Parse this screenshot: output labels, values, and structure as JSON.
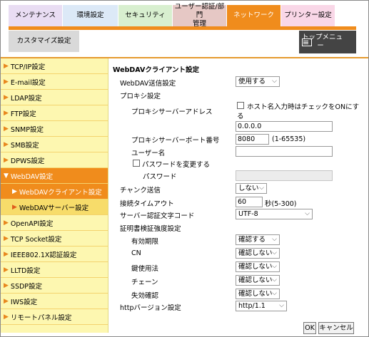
{
  "tabs": {
    "maintenance": "メンテナンス",
    "environment": "環境設定",
    "security": "セキュリティ",
    "user_auth_line1": "ユーザー認証/部門",
    "user_auth_line2": "管理",
    "network": "ネットワーク",
    "printer": "プリンター設定",
    "customize": "カスタマイズ設定"
  },
  "top_menu": {
    "line1": "トップメニュ",
    "line2": "ー"
  },
  "sidebar": {
    "items": [
      "TCP/IP設定",
      "E-mail設定",
      "LDAP設定",
      "FTP設定",
      "SNMP設定",
      "SMB設定",
      "DPWS設定",
      "WebDAV設定",
      "WebDAVクライアント設定",
      "WebDAVサーバー設定",
      "OpenAPI設定",
      "TCP Socket設定",
      "IEEE802.1X認証設定",
      "LLTD設定",
      "SSDP設定",
      "IWS設定",
      "リモートパネル設定"
    ]
  },
  "form": {
    "title": "WebDAVクライアント設定",
    "send_setting": {
      "label": "WebDAV送信設定",
      "value": "使用する"
    },
    "proxy_settings": "プロキシ設定",
    "proxy_address": {
      "label": "プロキシサーバーアドレス",
      "hostname_check_line1": "ホスト名入力時はチェックをONにす",
      "hostname_check_line2": "る",
      "value": "0.0.0.0"
    },
    "proxy_port": {
      "label": "プロキシサーバーポート番号",
      "value": "8080",
      "range": "(1-65535)"
    },
    "username": {
      "label": "ユーザー名",
      "value": ""
    },
    "change_password": "パスワードを変更する",
    "password": {
      "label": "パスワード",
      "value": ""
    },
    "chunk": {
      "label": "チャンク送信",
      "value": "しない"
    },
    "timeout": {
      "label": "接続タイムアウト",
      "value": "60",
      "unit": "秒(5-300)"
    },
    "auth_charset": {
      "label": "サーバー認証文字コード",
      "value": "UTF-8"
    },
    "cert_strength": "証明書検証強度設定",
    "validity": {
      "label": "有効期限",
      "value": "確認する"
    },
    "cn": {
      "label": "CN",
      "value": "確認しない"
    },
    "key_usage": {
      "label": "鍵使用法",
      "value": "確認しない"
    },
    "chain": {
      "label": "チェーン",
      "value": "確認しない"
    },
    "expiration_check": {
      "label": "失効確認",
      "value": "確認しない"
    },
    "http_version": {
      "label": "httpバージョン設定",
      "value": "http/1.1"
    }
  },
  "buttons": {
    "ok": "OK",
    "cancel": "キャンセル"
  },
  "colors": {
    "accent": "#f08c1c",
    "sidebar_bg": "#fdf7b0",
    "sub_bg": "#f7dc6a"
  }
}
